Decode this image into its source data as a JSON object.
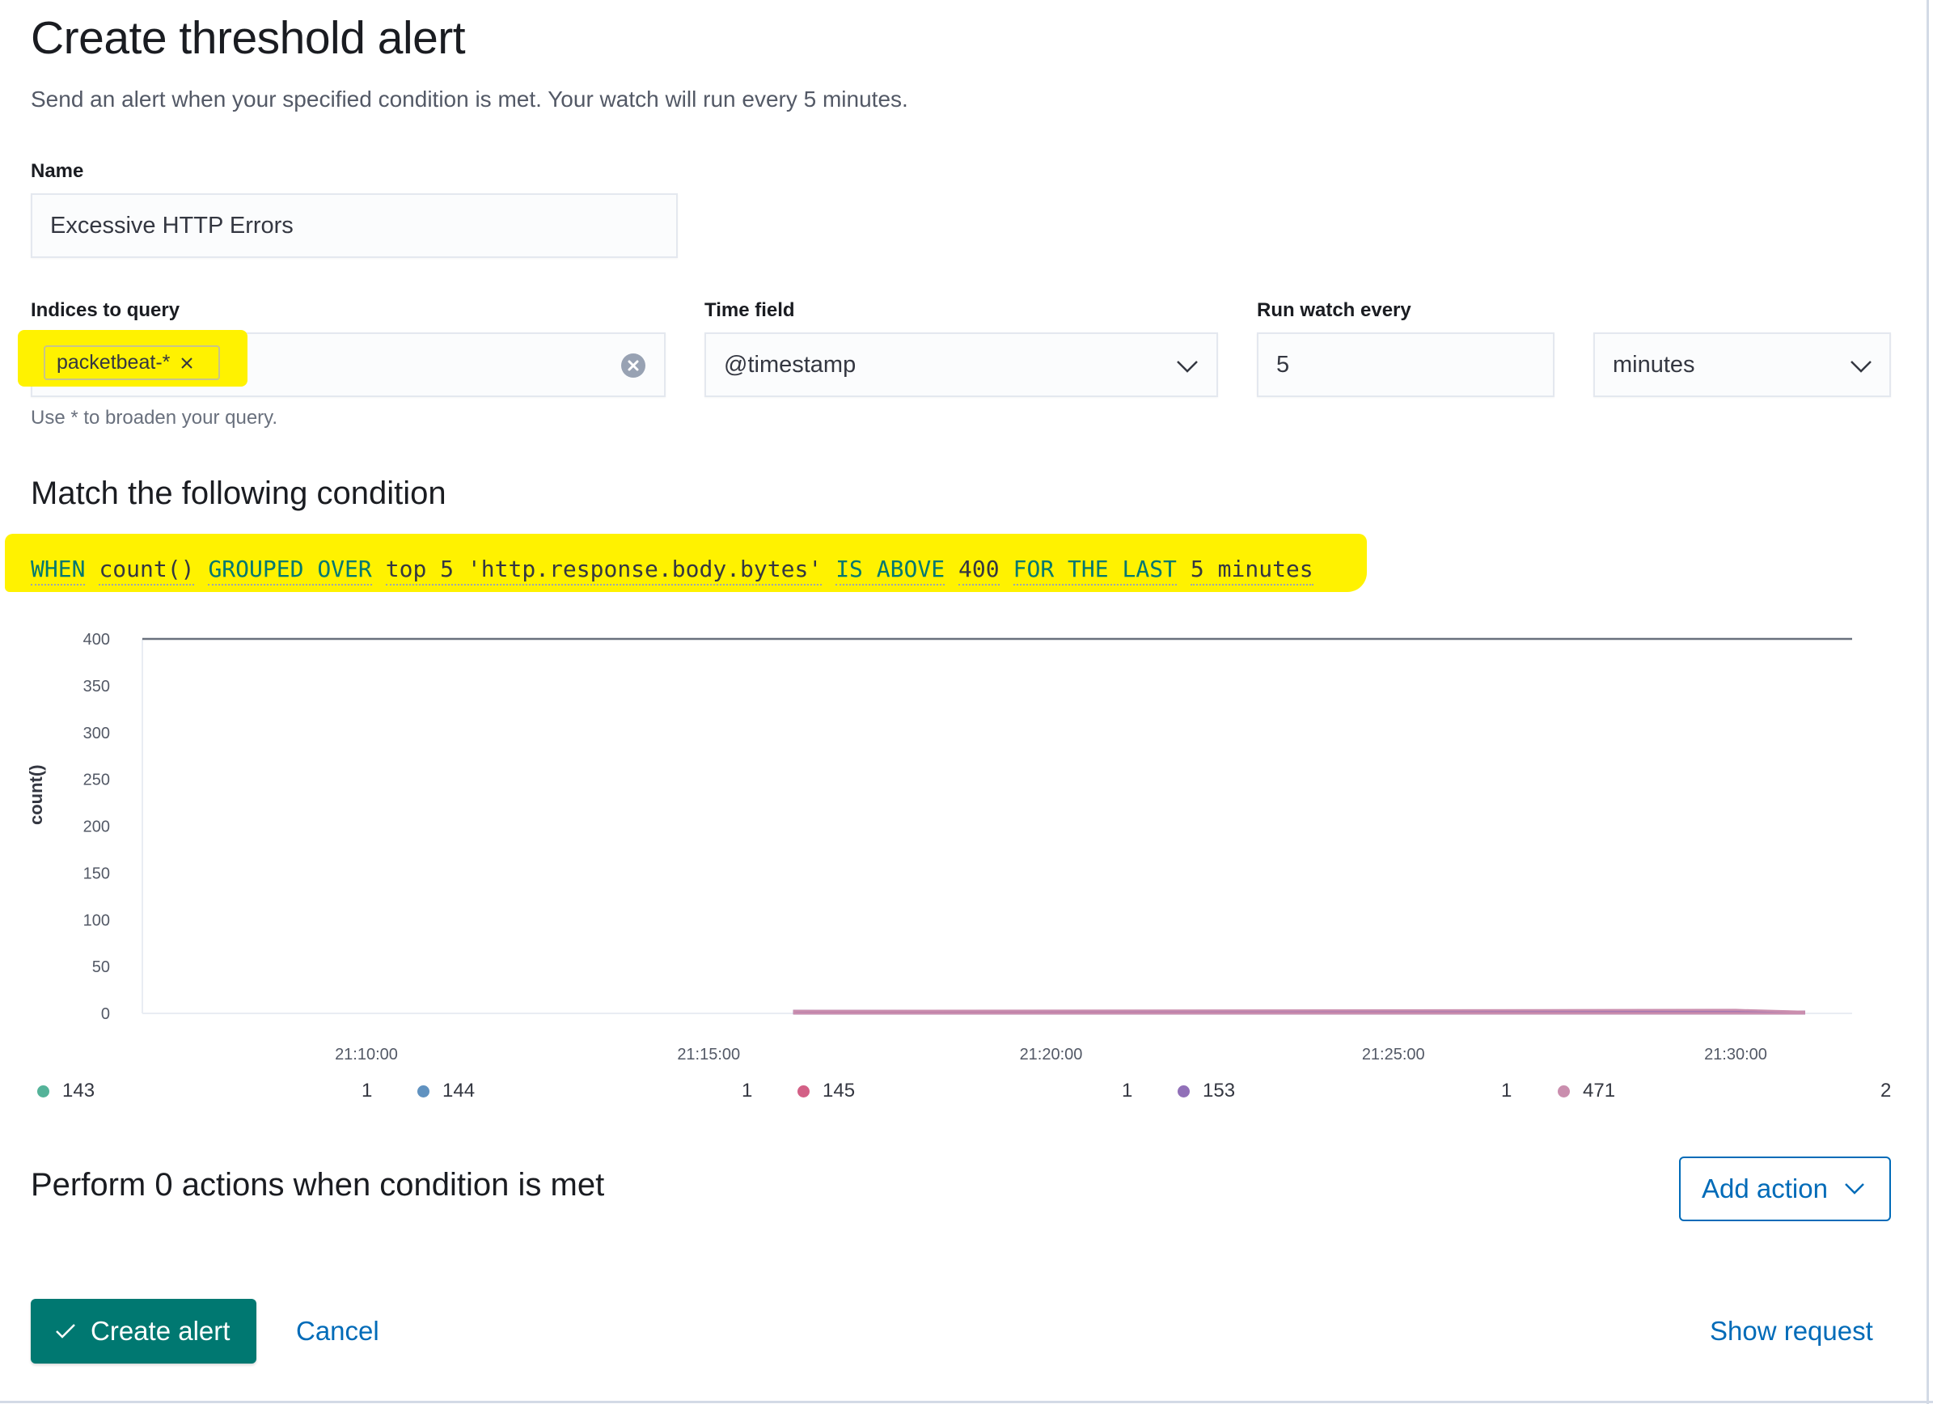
{
  "page": {
    "title": "Create threshold alert",
    "description": "Send an alert when your specified condition is met. Your watch will run every 5 minutes."
  },
  "form": {
    "name_label": "Name",
    "name_value": "Excessive HTTP Errors",
    "indices_label": "Indices to query",
    "indices_chips": [
      "packetbeat-*"
    ],
    "indices_help": "Use * to broaden your query.",
    "time_field_label": "Time field",
    "time_field_value": "@timestamp",
    "run_every_label": "Run watch every",
    "run_every_value": "5",
    "run_every_unit": "minutes"
  },
  "condition": {
    "title": "Match the following condition",
    "tokens": [
      {
        "kw": "WHEN",
        "value": "count()"
      },
      {
        "kw": "GROUPED OVER",
        "value": "top 5 'http.response.body.bytes'"
      },
      {
        "kw": "IS ABOVE",
        "value": "400"
      },
      {
        "kw": "FOR THE LAST",
        "value": "5 minutes"
      }
    ]
  },
  "chart_data": {
    "type": "area",
    "title": "",
    "ylabel": "count()",
    "xlabel": "",
    "ylim": [
      0,
      400
    ],
    "y_ticks": [
      "0",
      "50",
      "100",
      "150",
      "200",
      "250",
      "300",
      "350",
      "400"
    ],
    "x_ticks": [
      "21:10:00",
      "21:15:00",
      "21:20:00",
      "21:25:00",
      "21:30:00"
    ],
    "threshold": 400,
    "x": [
      "21:16:15",
      "21:17:15",
      "21:30:00",
      "21:31:00"
    ],
    "series": [
      {
        "name": "143",
        "total": "1",
        "color": "#54b399",
        "values": [
          1,
          0,
          0,
          0
        ]
      },
      {
        "name": "144",
        "total": "1",
        "color": "#6092c0",
        "values": [
          1,
          0,
          0,
          0
        ]
      },
      {
        "name": "145",
        "total": "1",
        "color": "#d36086",
        "values": [
          1,
          0,
          0,
          0
        ]
      },
      {
        "name": "153",
        "total": "1",
        "color": "#9170b8",
        "values": [
          1,
          1,
          1,
          0
        ]
      },
      {
        "name": "471",
        "total": "2",
        "color": "#ca8eae",
        "values": [
          1,
          1,
          2,
          0
        ]
      }
    ],
    "legend_position": "bottom",
    "grid": false
  },
  "actions": {
    "title": "Perform 0 actions when condition is met",
    "add_action_label": "Add action"
  },
  "footer": {
    "create_label": "Create alert",
    "cancel_label": "Cancel",
    "show_request_label": "Show request"
  },
  "colors": {
    "primary": "#007871",
    "link": "#006bb8",
    "highlight": "#fff200"
  },
  "icons": {
    "clear": "clear-icon",
    "remove_chip": "close-icon",
    "dropdown": "chevron-down-icon",
    "check": "check-icon"
  }
}
